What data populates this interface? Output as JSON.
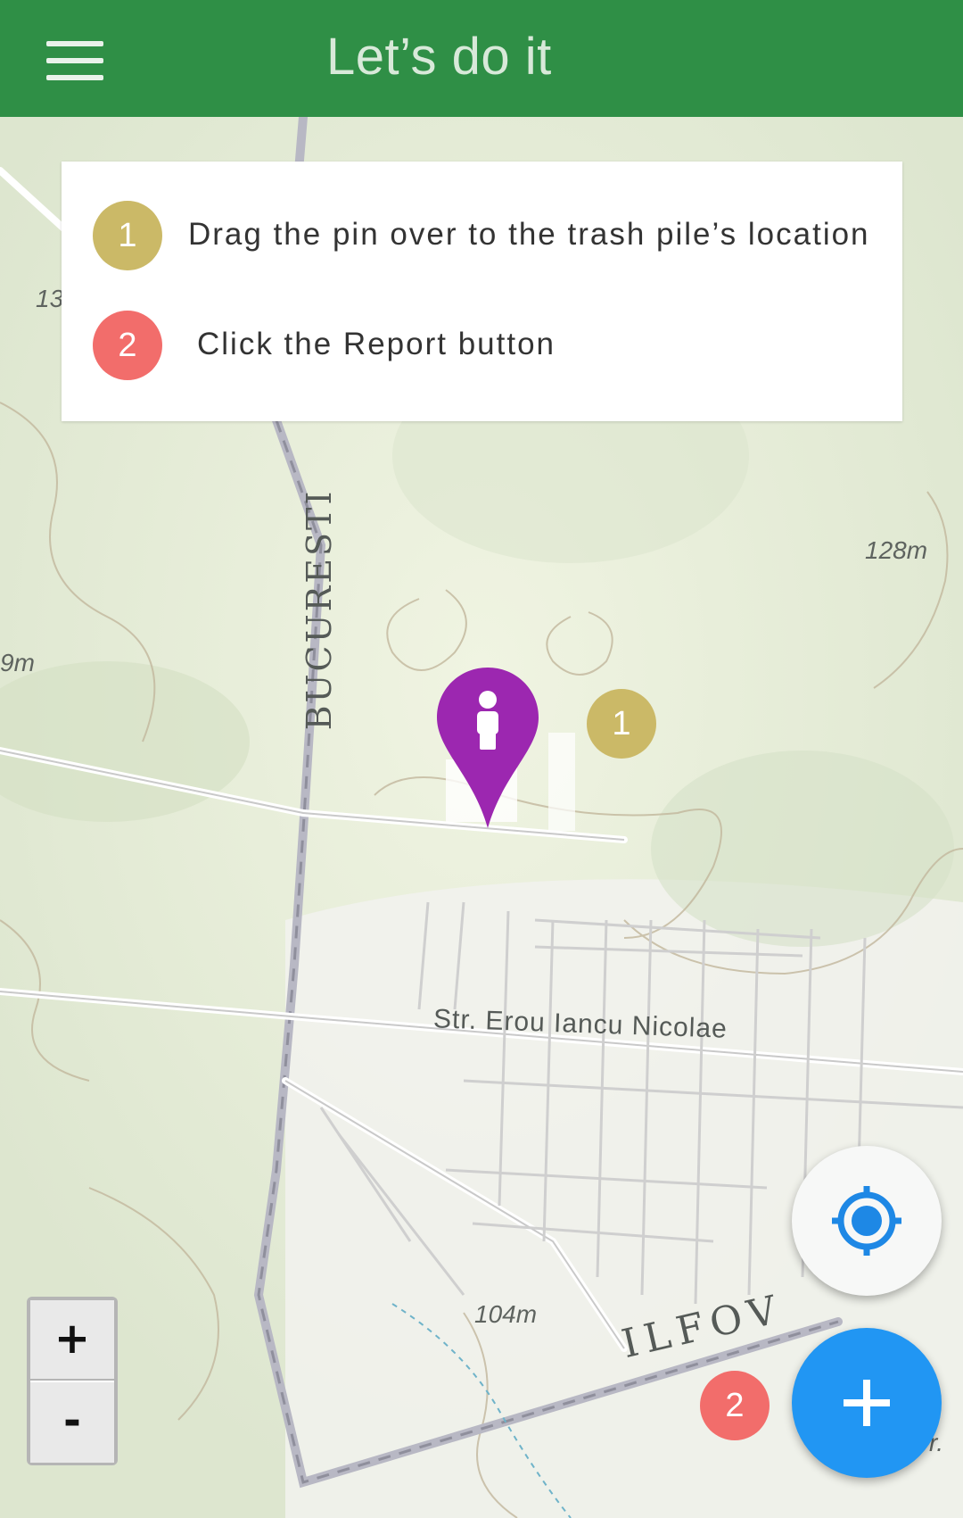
{
  "app": {
    "title": "Let’s do it",
    "menu_icon": "hamburger-menu-icon",
    "primary_color": "#2f8f46"
  },
  "instructions": {
    "steps": [
      {
        "number": "1",
        "text": "Drag the pin over to the trash pile’s location",
        "color": "#cbb967"
      },
      {
        "number": "2",
        "text": "Click the Report button",
        "color": "#f26d6b"
      }
    ]
  },
  "map": {
    "labels": {
      "road_bucuresti": "BUCURESTI",
      "street": "Str. Erou Iancu Nicolae",
      "county": "ILFOV",
      "elev_128": "128m",
      "elev_104": "104m",
      "elev_9": "9m",
      "elev_13": "13",
      "edge_tr": "r."
    },
    "pin_icon": "person-pin-icon",
    "pin_color": "#9c27b0",
    "pin_badge": "1",
    "report_badge": "2"
  },
  "controls": {
    "zoom_in": "+",
    "zoom_out": "-",
    "locate_icon": "gps-locate-icon",
    "add_icon": "plus-icon",
    "add_color": "#2196f3"
  }
}
